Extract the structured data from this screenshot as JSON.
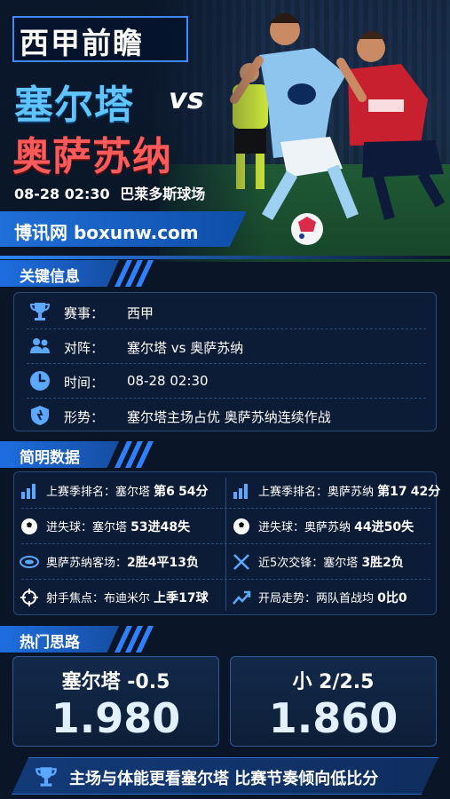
{
  "header": {
    "title": "西甲前瞻",
    "team_a": "塞尔塔",
    "vs": "vs",
    "team_b": "奥萨苏纳",
    "match_time": "08-28 02:30",
    "venue": "巴莱多斯球场",
    "brand": "博讯网 boxunw.com"
  },
  "key_info": {
    "section_title": "关键信息",
    "rows": [
      {
        "icon": "trophy-icon",
        "label": "赛事：",
        "value": "西甲"
      },
      {
        "icon": "users-icon",
        "label": "对阵：",
        "value": "塞尔塔 vs 奥萨苏纳"
      },
      {
        "icon": "clock-icon",
        "label": "时间：",
        "value": "08-28 02:30"
      },
      {
        "icon": "shield-icon",
        "label": "形势：",
        "value": "塞尔塔主场占优   奥萨苏纳连续作战"
      }
    ]
  },
  "stats": {
    "section_title": "简明数据",
    "cells": [
      {
        "icon": "bar-chart-icon",
        "label": "上赛季排名：",
        "text": "塞尔塔",
        "bold": "第6",
        "extra": "54分"
      },
      {
        "icon": "bar-chart-icon",
        "label": "上赛季排名：",
        "text": "奥萨苏纳",
        "bold": "第17",
        "extra": "42分"
      },
      {
        "icon": "football-icon",
        "label": "进失球：",
        "text": "塞尔塔",
        "bold": "53进48失",
        "extra": ""
      },
      {
        "icon": "football-icon",
        "label": "进失球：",
        "text": "奥萨苏纳",
        "bold": "44进50失",
        "extra": ""
      },
      {
        "icon": "stadium-icon",
        "label": "奥萨苏纳客场：",
        "text": "",
        "bold": "2胜4平13负",
        "extra": ""
      },
      {
        "icon": "swords-icon",
        "label": "近5次交锋：",
        "text": "塞尔塔",
        "bold": "3胜2负",
        "extra": ""
      },
      {
        "icon": "crosshair-icon",
        "label": "射手焦点：",
        "text": "布迪米尔",
        "bold": "",
        "extra": "上季17球"
      },
      {
        "icon": "trend-icon",
        "label": "开局走势：",
        "text": "两队首战均",
        "bold": "0比0",
        "extra": ""
      }
    ]
  },
  "tips": {
    "section_title": "热门思路",
    "cards": [
      {
        "title": "塞尔塔 -0.5",
        "odds": "1.980"
      },
      {
        "title": "小 2/2.5",
        "odds": "1.860"
      }
    ]
  },
  "footer": {
    "icon": "trophy-icon",
    "text": "主场与体能更看塞尔塔  比赛节奏倾向低比分"
  },
  "colors": {
    "accent": "#2f80ff",
    "team_a": "#5fc4ff",
    "team_b": "#ff5a5a",
    "background": "#0a1628"
  }
}
